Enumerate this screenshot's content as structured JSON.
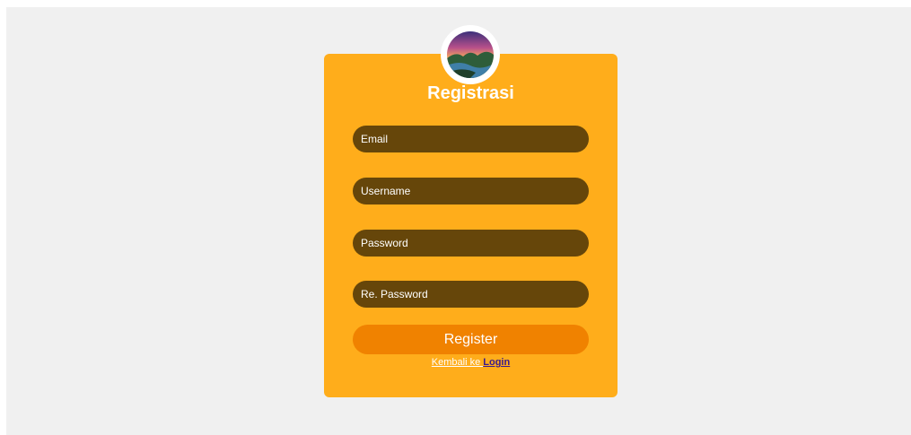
{
  "colors": {
    "page_background": "#f0f0f0",
    "card_background": "#ffad1b",
    "field_background": "#66460a",
    "button_background": "#f08200",
    "link_color": "#3a1a8c"
  },
  "avatar": {
    "icon": "landscape-sunset-photo"
  },
  "form": {
    "title": "Registrasi",
    "email_placeholder": "Email",
    "username_placeholder": "Username",
    "password_placeholder": "Password",
    "repassword_placeholder": "Re. Password",
    "register_label": "Register",
    "back_prefix": "Kembali ke ",
    "back_link_label": "Login"
  }
}
